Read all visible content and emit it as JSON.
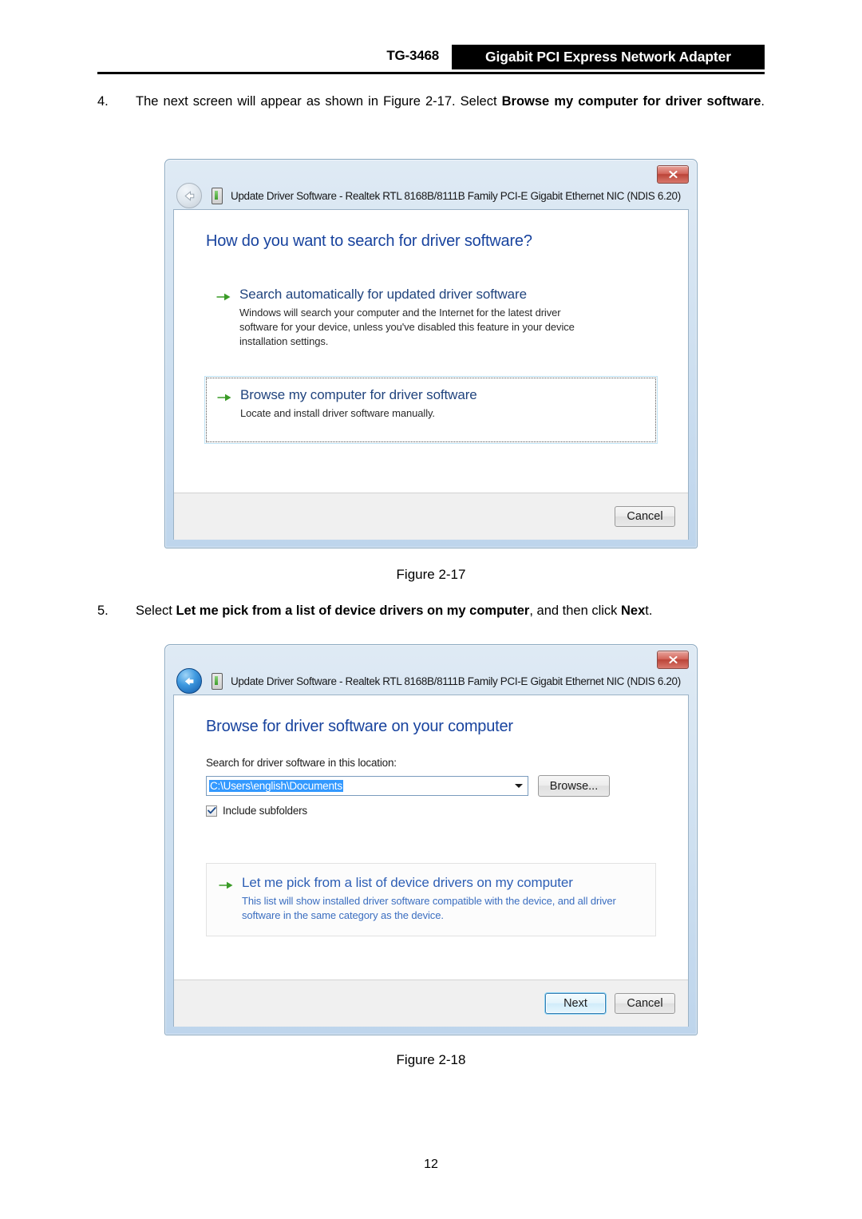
{
  "header": {
    "model": "TG-3468",
    "product": "Gigabit PCI Express Network Adapter"
  },
  "steps": [
    {
      "number": "4.",
      "text_part1": "The next screen will appear as shown in Figure 2-17. Select ",
      "bold1": "Browse my computer for driver software",
      "text_part2": "."
    },
    {
      "number": "5.",
      "text_part1": "Select ",
      "bold1": "Let me pick from a list of device drivers on my computer",
      "text_part2": ", and then click ",
      "bold2": "Nex",
      "text_part3": "t."
    }
  ],
  "figure_captions": {
    "fig_217": "Figure 2-17",
    "fig_218": "Figure 2-18"
  },
  "page_number": "12",
  "dialog1": {
    "title": "Update Driver Software - Realtek RTL 8168B/8111B Family PCI-E Gigabit Ethernet NIC (NDIS 6.20)",
    "heading": "How do you want to search for driver software?",
    "options": [
      {
        "title": "Search automatically for updated driver software",
        "desc": "Windows will search your computer and the Internet for the latest driver software for your device, unless you've disabled this feature in your device installation settings."
      },
      {
        "title": "Browse my computer for driver software",
        "desc": "Locate and install driver software manually."
      }
    ],
    "cancel_label": "Cancel",
    "close_label": "x"
  },
  "dialog2": {
    "title": "Update Driver Software - Realtek RTL 8168B/8111B Family PCI-E Gigabit Ethernet NIC (NDIS 6.20)",
    "heading": "Browse for driver software on your computer",
    "location_label": "Search for driver software in this location:",
    "location_value": "C:\\Users\\english\\Documents",
    "browse_label": "Browse...",
    "include_subfolders_label": "Include subfolders",
    "option": {
      "title": "Let me pick from a list of device drivers on my computer",
      "desc": "This list will show installed driver software compatible with the device, and all driver software in the same category as the device."
    },
    "next_label": "Next",
    "cancel_label": "Cancel",
    "close_label": "x"
  },
  "colors": {
    "header_band": "#000000",
    "dialog_heading": "#18439e",
    "option_title": "#21447e",
    "option_link": "#2e5fb5",
    "selection_blue": "#3399ff",
    "arrow_green": "#3a9b27",
    "close_red": "#bb4438"
  }
}
